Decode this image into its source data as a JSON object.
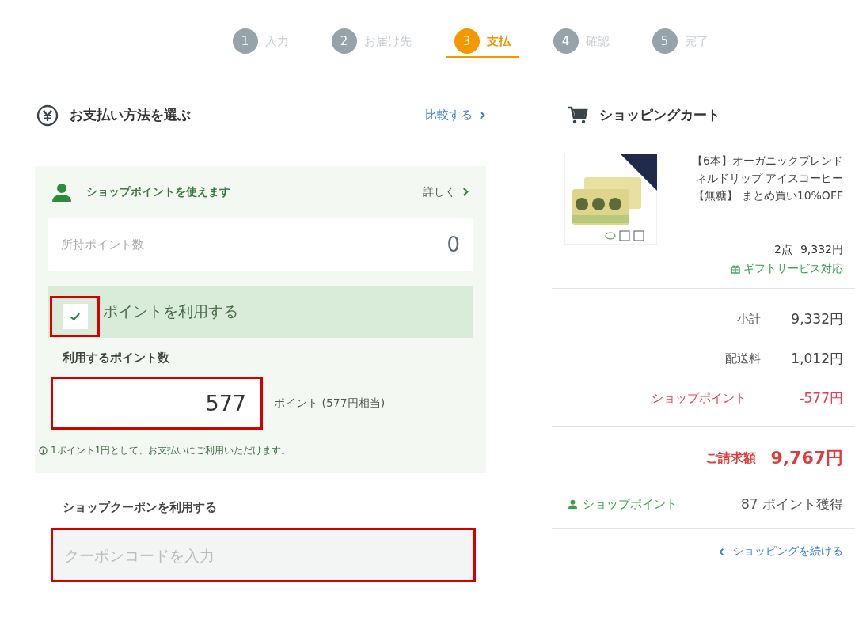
{
  "steps": [
    {
      "number": "1",
      "label": "入力",
      "selected": false
    },
    {
      "number": "2",
      "label": "お届け先",
      "selected": false
    },
    {
      "number": "3",
      "label": "支払",
      "selected": true
    },
    {
      "number": "4",
      "label": "確認",
      "selected": false
    },
    {
      "number": "5",
      "label": "完了",
      "selected": false
    }
  ],
  "payment": {
    "title": "お支払い方法を選ぶ",
    "compare_link": "比較する",
    "points_panel": {
      "title": "ショップポイントを使えます",
      "details_link": "詳しく",
      "owned_label": "所持ポイント数",
      "owned_value": "0",
      "use_checkbox": {
        "label": "ポイントを利用する",
        "checked": true,
        "highlighted": true
      },
      "amount_label": "利用するポイント数",
      "amount_field": {
        "value": "577",
        "highlighted": true
      },
      "amount_suffix": "ポイント (577円相当)",
      "note": "1ポイント1円として、お支払いにご利用いただけます。"
    },
    "coupon": {
      "label": "ショップクーポンを利用する",
      "field": {
        "placeholder": "クーポンコードを入力",
        "highlighted": true
      }
    }
  },
  "cart": {
    "title": "ショッピングカート",
    "items": [
      {
        "kind": "picture",
        "name_lines": [
          "【6本】オーガニックブレンド",
          "ネルドリップ アイスコーヒー",
          "【無糖】 まとめ買い10%OFF"
        ],
        "quantity": "2点",
        "price": "9,332円",
        "gift": "ギフトサービス対応"
      }
    ],
    "summary": [
      {
        "label": "小計",
        "value": "9,332円",
        "kind": "normal"
      },
      {
        "label": "配送料",
        "value": "1,012円",
        "kind": "normal"
      },
      {
        "label": "ショップポイント",
        "value": "-577円",
        "kind": "discount"
      }
    ],
    "total": {
      "label": "ご請求額",
      "value": "9,767円"
    },
    "points_earned": {
      "label": "ショップポイント",
      "value": "87 ポイント獲得"
    },
    "continue_link": "ショッピングを続ける"
  }
}
